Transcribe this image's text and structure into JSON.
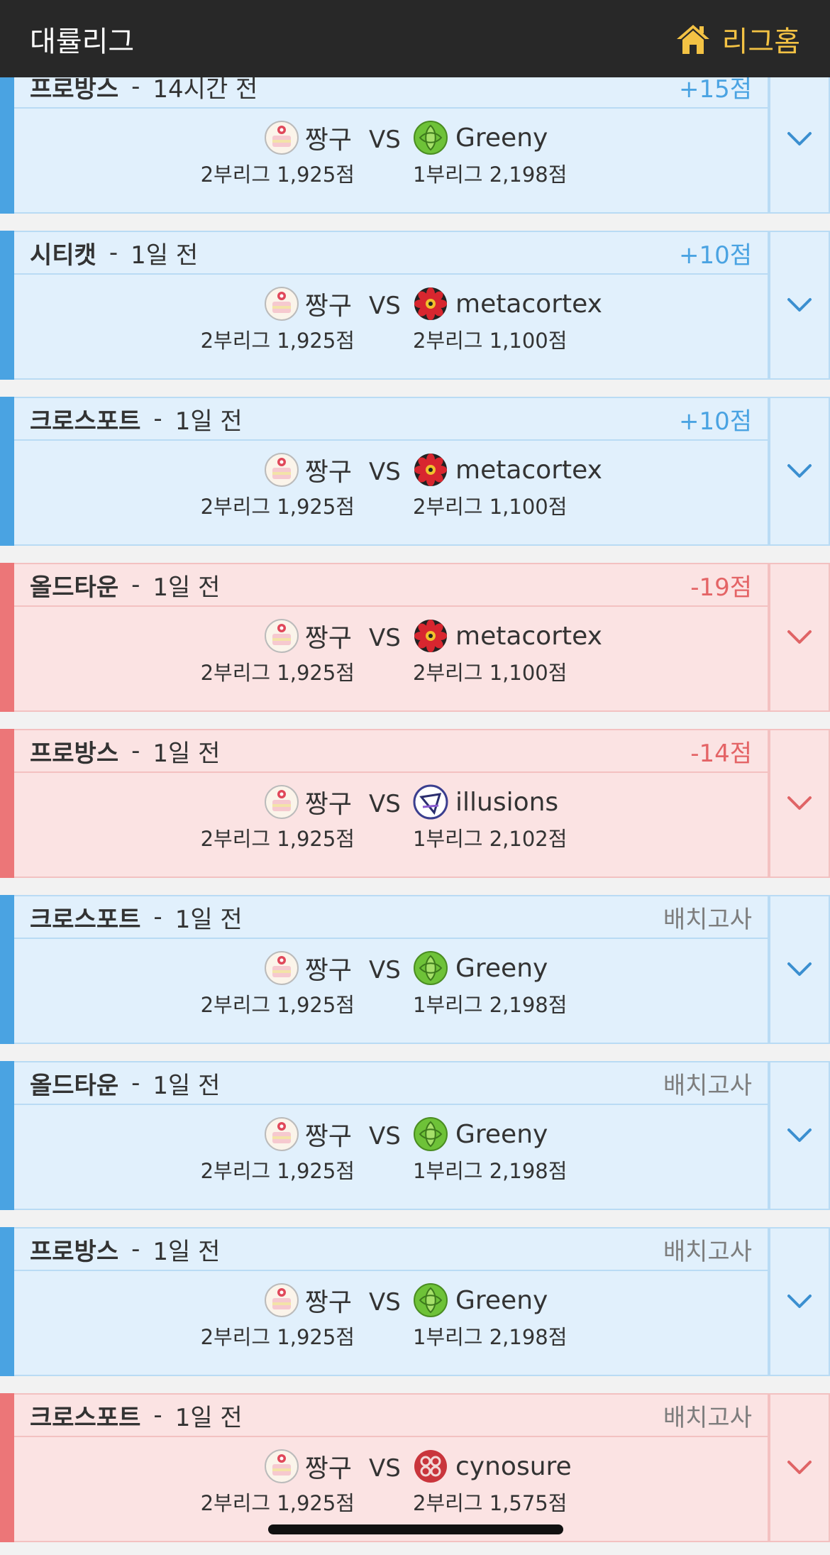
{
  "header": {
    "title": "대률리그",
    "home_label": "리그홈"
  },
  "colors": {
    "win": "#4aa3e2",
    "loss": "#ec7678",
    "placement": "#7d7d7d",
    "header_bg": "#282828",
    "home_accent": "#f3c244"
  },
  "matches": [
    {
      "outcome": "win",
      "map": "프로방스",
      "sep": "-",
      "time": "14시간 전",
      "result": "+15점",
      "placement": false,
      "me": {
        "name": "짱구",
        "rank": "2부리그 1,925점",
        "avatar": "cake-avatar-icon"
      },
      "vs": "VS",
      "opp": {
        "name": "Greeny",
        "rank": "1부리그 2,198점",
        "avatar": "green-avatar-icon"
      }
    },
    {
      "outcome": "win",
      "map": "시티캣",
      "sep": "-",
      "time": "1일 전",
      "result": "+10점",
      "placement": false,
      "me": {
        "name": "짱구",
        "rank": "2부리그 1,925점",
        "avatar": "cake-avatar-icon"
      },
      "vs": "VS",
      "opp": {
        "name": "metacortex",
        "rank": "2부리그 1,100점",
        "avatar": "flower-avatar-icon"
      }
    },
    {
      "outcome": "win",
      "map": "크로스포트",
      "sep": "-",
      "time": "1일 전",
      "result": "+10점",
      "placement": false,
      "me": {
        "name": "짱구",
        "rank": "2부리그 1,925점",
        "avatar": "cake-avatar-icon"
      },
      "vs": "VS",
      "opp": {
        "name": "metacortex",
        "rank": "2부리그 1,100점",
        "avatar": "flower-avatar-icon"
      }
    },
    {
      "outcome": "loss",
      "map": "올드타운",
      "sep": "-",
      "time": "1일 전",
      "result": "-19점",
      "placement": false,
      "me": {
        "name": "짱구",
        "rank": "2부리그 1,925점",
        "avatar": "cake-avatar-icon"
      },
      "vs": "VS",
      "opp": {
        "name": "metacortex",
        "rank": "2부리그 1,100점",
        "avatar": "flower-avatar-icon"
      }
    },
    {
      "outcome": "loss",
      "map": "프로방스",
      "sep": "-",
      "time": "1일 전",
      "result": "-14점",
      "placement": false,
      "me": {
        "name": "짱구",
        "rank": "2부리그 1,925점",
        "avatar": "cake-avatar-icon"
      },
      "vs": "VS",
      "opp": {
        "name": "illusions",
        "rank": "1부리그 2,102점",
        "avatar": "illusion-avatar-icon"
      }
    },
    {
      "outcome": "win",
      "map": "크로스포트",
      "sep": "-",
      "time": "1일 전",
      "result": "배치고사",
      "placement": true,
      "me": {
        "name": "짱구",
        "rank": "2부리그 1,925점",
        "avatar": "cake-avatar-icon"
      },
      "vs": "VS",
      "opp": {
        "name": "Greeny",
        "rank": "1부리그 2,198점",
        "avatar": "green-avatar-icon"
      }
    },
    {
      "outcome": "win",
      "map": "올드타운",
      "sep": "-",
      "time": "1일 전",
      "result": "배치고사",
      "placement": true,
      "me": {
        "name": "짱구",
        "rank": "2부리그 1,925점",
        "avatar": "cake-avatar-icon"
      },
      "vs": "VS",
      "opp": {
        "name": "Greeny",
        "rank": "1부리그 2,198점",
        "avatar": "green-avatar-icon"
      }
    },
    {
      "outcome": "win",
      "map": "프로방스",
      "sep": "-",
      "time": "1일 전",
      "result": "배치고사",
      "placement": true,
      "me": {
        "name": "짱구",
        "rank": "2부리그 1,925점",
        "avatar": "cake-avatar-icon"
      },
      "vs": "VS",
      "opp": {
        "name": "Greeny",
        "rank": "1부리그 2,198점",
        "avatar": "green-avatar-icon"
      }
    },
    {
      "outcome": "loss",
      "map": "크로스포트",
      "sep": "-",
      "time": "1일 전",
      "result": "배치고사",
      "placement": true,
      "me": {
        "name": "짱구",
        "rank": "2부리그 1,925점",
        "avatar": "cake-avatar-icon"
      },
      "vs": "VS",
      "opp": {
        "name": "cynosure",
        "rank": "2부리그 1,575점",
        "avatar": "cynosure-avatar-icon"
      }
    }
  ]
}
